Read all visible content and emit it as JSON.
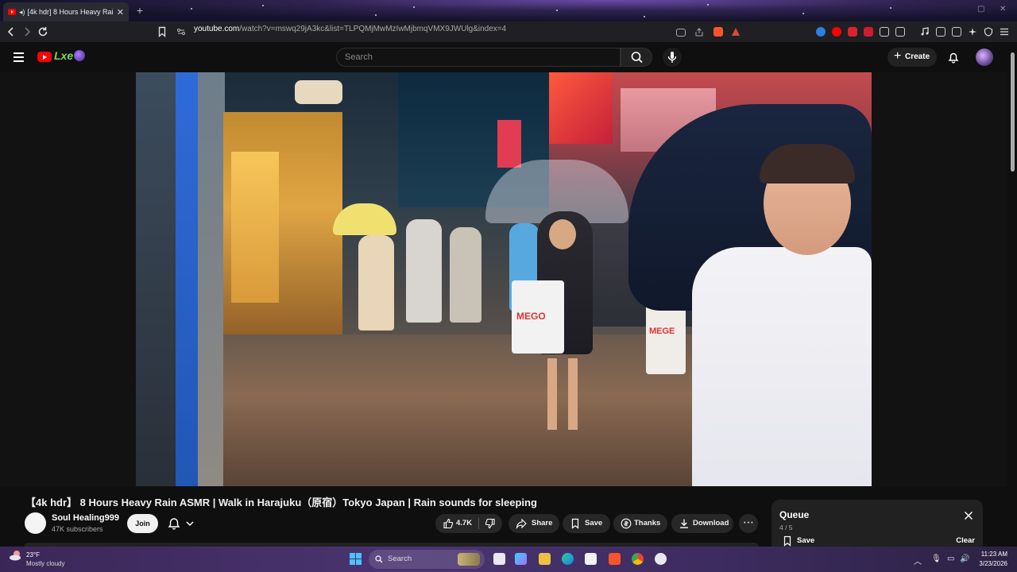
{
  "browser": {
    "tab_title": "[4k hdr] 8 Hours Heavy Rain",
    "url_domain": "youtube.com",
    "url_path": "/watch?v=mswq29jA3kc&list=TLPQMjMwMzIwMjbmqVMX9JWUlg&index=4"
  },
  "youtube": {
    "search_placeholder": "Search",
    "create_label": "Create",
    "doodle_text": "Lxe"
  },
  "video": {
    "title": "【4k hdr】 8 Hours Heavy Rain ASMR | Walk in Harajuku（原宿）Tokyo Japan | Rain sounds for sleeping",
    "shopping_bag_text": "MEGO",
    "shopping_bag_text_2": "MEGE"
  },
  "channel": {
    "name": "Soul Healing999",
    "subscribers": "47K subscribers",
    "join_label": "Join"
  },
  "actions": {
    "like_count": "4.7K",
    "share": "Share",
    "save": "Save",
    "thanks": "Thanks",
    "download": "Download"
  },
  "queue": {
    "title": "Queue",
    "position": "4 / 5",
    "save_label": "Save",
    "clear_label": "Clear"
  },
  "taskbar": {
    "temperature": "23°F",
    "condition": "Mostly cloudy",
    "search_label": "Search",
    "time": "11:23 AM",
    "date": "3/23/2026"
  },
  "colors": {
    "youtube_red": "#ff0000",
    "page_bg": "#0f0f0f",
    "pill_bg": "#272727"
  }
}
